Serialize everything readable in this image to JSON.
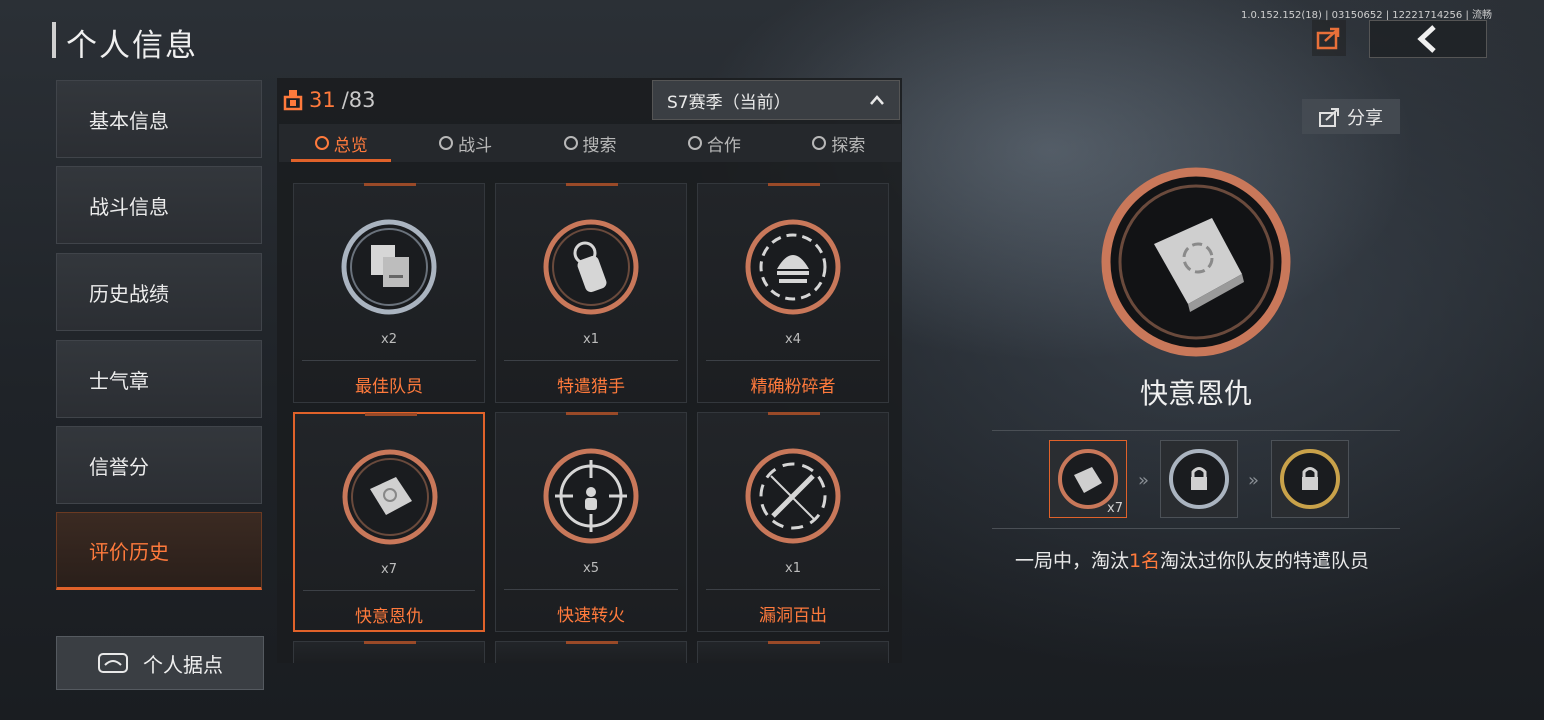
{
  "header": {
    "title": "个人信息",
    "build": "1.0.152.152(18) | 03150652 | 12221714256 | 流畅"
  },
  "share": {
    "label": "分享"
  },
  "sidebar": {
    "items": [
      {
        "label": "基本信息"
      },
      {
        "label": "战斗信息"
      },
      {
        "label": "历史战绩"
      },
      {
        "label": "士气章"
      },
      {
        "label": "信誉分"
      },
      {
        "label": "评价历史"
      }
    ],
    "base_label": "个人据点"
  },
  "progress": {
    "current": "31",
    "total": "/83"
  },
  "season": {
    "label": "S7赛季（当前）"
  },
  "tabs": [
    {
      "label": "总览"
    },
    {
      "label": "战斗"
    },
    {
      "label": "搜索"
    },
    {
      "label": "合作"
    },
    {
      "label": "探索"
    }
  ],
  "badges": [
    {
      "name": "最佳队员",
      "qty": "x2",
      "ring": "silver",
      "icon": "documents-icon"
    },
    {
      "name": "特遣猎手",
      "qty": "x1",
      "ring": "bronze",
      "icon": "dogtag-icon"
    },
    {
      "name": "精确粉碎者",
      "qty": "x4",
      "ring": "bronze",
      "icon": "helmet-icon"
    },
    {
      "name": "快意恩仇",
      "qty": "x7",
      "ring": "bronze",
      "icon": "book-icon"
    },
    {
      "name": "快速转火",
      "qty": "x5",
      "ring": "bronze",
      "icon": "crosshair-icon"
    },
    {
      "name": "漏洞百出",
      "qty": "x1",
      "ring": "bronze",
      "icon": "rifle-icon"
    }
  ],
  "detail": {
    "name": "快意恩仇",
    "tier_qty": "x7",
    "desc_pre": "一局中，淘汰",
    "desc_hl": "1名",
    "desc_post": "淘汰过你队友的特遣队员"
  },
  "colors": {
    "accent": "#ff7a3c",
    "bronze": "#c9785a",
    "silver": "#aab4c0",
    "gold": "#c9a24a"
  }
}
